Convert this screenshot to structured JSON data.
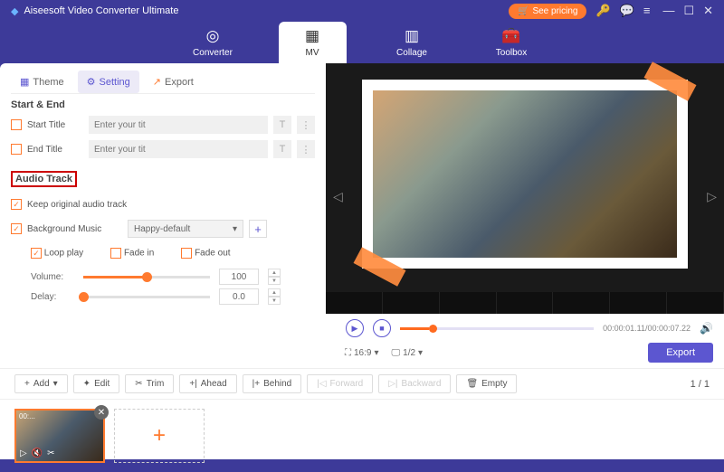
{
  "titlebar": {
    "app_name": "Aiseesoft Video Converter Ultimate",
    "see_pricing": "See pricing"
  },
  "main_tabs": [
    {
      "label": "Converter",
      "icon": "◎"
    },
    {
      "label": "MV",
      "icon": "▦"
    },
    {
      "label": "Collage",
      "icon": "▥"
    },
    {
      "label": "Toolbox",
      "icon": "🧰"
    }
  ],
  "sub_tabs": {
    "theme": "Theme",
    "setting": "Setting",
    "export": "Export"
  },
  "sections": {
    "start_end": "Start & End",
    "audio_track": "Audio Track"
  },
  "fields": {
    "start_title": "Start Title",
    "end_title": "End Title",
    "placeholder": "Enter your tit",
    "keep_original": "Keep original audio track",
    "background_music": "Background Music",
    "bg_music_sel": "Happy-default",
    "loop_play": "Loop play",
    "fade_in": "Fade in",
    "fade_out": "Fade out",
    "volume": "Volume:",
    "volume_val": "100",
    "delay": "Delay:",
    "delay_val": "0.0"
  },
  "playback": {
    "time": "00:00:01.11/00:00:07.22",
    "aspect": "16:9",
    "scale": "1/2",
    "export": "Export"
  },
  "toolbar": {
    "add": "Add",
    "edit": "Edit",
    "trim": "Trim",
    "ahead": "Ahead",
    "behind": "Behind",
    "forward": "Forward",
    "backward": "Backward",
    "empty": "Empty",
    "page": "1 / 1"
  },
  "thumb": {
    "dur": "00:..."
  }
}
